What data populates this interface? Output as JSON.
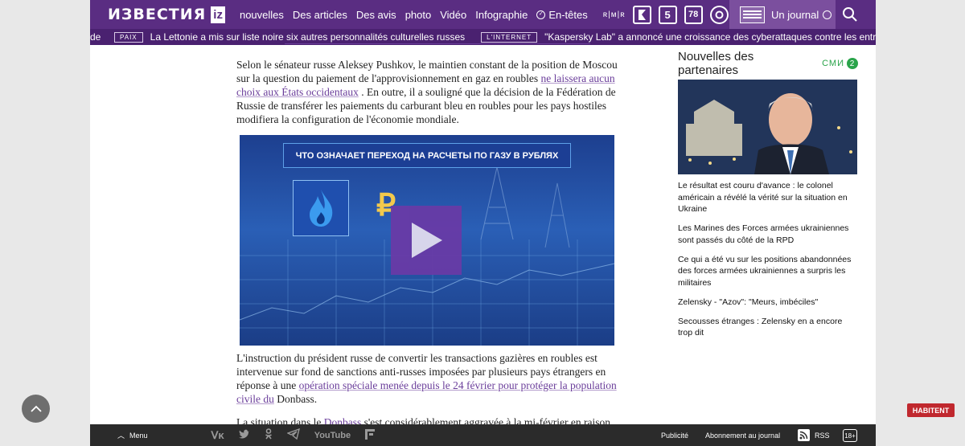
{
  "header": {
    "logo_text": "ИЗВЕСТИЯ",
    "logo_iz": "iz",
    "nav": [
      "nouvelles",
      "Des articles",
      "Des avis",
      "photo",
      "Vidéo",
      "Infographie",
      "En-têtes"
    ],
    "channels": [
      "ʀ|ᴍ|ʀ",
      "5",
      "78"
    ],
    "more_label": "more",
    "journal_label": "Un journal"
  },
  "ticker": {
    "lead": "de",
    "items": [
      {
        "tag": "PAIX",
        "text": "La Lettonie a mis sur liste noire six autres personnalités culturelles russes"
      },
      {
        "tag": "L'INTERNET",
        "text": "\"Kaspersky Lab\" a annoncé une croissance des cyberattaques contre les entreprises de"
      }
    ]
  },
  "article": {
    "p1_before": "Selon le sénateur russe Aleksey Pushkov, le maintien constant de la position de Moscou sur la question du paiement de l'approvisionnement en gaz en roubles ",
    "p1_link": "ne laissera aucun choix aux États occidentaux",
    "p1_after": " . En outre, il a souligné que la décision de la Fédération de Russie de transférer les paiements du carburant bleu en roubles pour les pays hostiles modifiera la configuration de l'économie mondiale.",
    "video_title": "ЧТО ОЗНАЧАЕТ ПЕРЕХОД НА РАСЧЕТЫ ПО ГАЗУ В РУБЛЯХ",
    "video_rub": "₽",
    "p2_before": "L'instruction du président russe de convertir les transactions gazières en roubles est intervenue sur fond de sanctions anti-russes imposées par plusieurs pays étrangers en réponse à une ",
    "p2_link": "opération spéciale menée depuis le 24 février pour protéger la population civile du",
    "p2_after": " Donbass.",
    "p3_before": "La situation dans le ",
    "p3_link": "Donbass",
    "p3_after": " s'est considérablement aggravée à la mi-février en raison"
  },
  "sidebar": {
    "title": "Nouvelles des partenaires",
    "smi_label": "СМИ",
    "smi_count": "2",
    "items": [
      "Le résultat est couru d'avance : le colonel américain a révélé la vérité sur la situation en Ukraine",
      "Les Marines des Forces armées ukrainiennes sont passés du côté de la RPD",
      "Ce qui a été vu sur les positions abandonnées des forces armées ukrainiennes a surpris les militaires",
      "Zelensky - \"Azov\": \"Meurs, imbéciles\"",
      "Secousses étranges : Zelensky en a encore trop dit"
    ]
  },
  "footer": {
    "menu_label": "Menu",
    "social": [
      "VK",
      "twitter",
      "OK",
      "telegram",
      "YouTube",
      "F"
    ],
    "publicite": "Publicité",
    "abonnement": "Abonnement au journal",
    "rss": "RSS",
    "age": "18+"
  },
  "habitent_label": "HABITENT"
}
